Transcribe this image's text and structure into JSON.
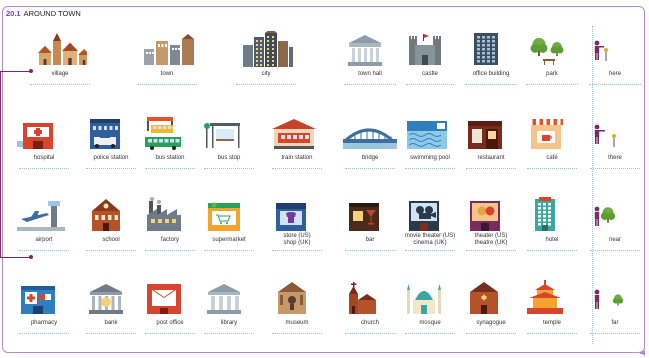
{
  "section": {
    "number": "20.1",
    "title": "AROUND TOWN"
  },
  "rows": [
    [
      "village",
      "town",
      "city",
      "town hall",
      "castle",
      "office building",
      "park",
      "here"
    ],
    [
      "hospital",
      "police station",
      "bus station",
      "bus stop",
      "train station",
      "bridge",
      "swimming pool",
      "restaurant",
      "café",
      "there"
    ],
    [
      "airport",
      "school",
      "factory",
      "supermarket",
      "store (US)\nshop (UK)",
      "bar",
      "movie theater (US)\ncinema (UK)",
      "theater (US)\ntheatre (UK)",
      "hotel",
      "near"
    ],
    [
      "pharmacy",
      "bank",
      "post office",
      "library",
      "museum",
      "church",
      "mosque",
      "synagogue",
      "temple",
      "far"
    ]
  ],
  "icons": [
    [
      "village-icon",
      "town-icon",
      "city-icon",
      "town-hall-icon",
      "castle-icon",
      "office-building-icon",
      "park-icon",
      "person-here-icon"
    ],
    [
      "hospital-icon",
      "police-station-icon",
      "bus-station-icon",
      "bus-stop-icon",
      "train-station-icon",
      "bridge-icon",
      "swimming-pool-icon",
      "restaurant-icon",
      "cafe-icon",
      "person-there-icon"
    ],
    [
      "airport-icon",
      "school-icon",
      "factory-icon",
      "supermarket-icon",
      "store-icon",
      "bar-icon",
      "cinema-icon",
      "theatre-icon",
      "hotel-icon",
      "person-near-tree-icon"
    ],
    [
      "pharmacy-icon",
      "bank-icon",
      "post-office-icon",
      "library-icon",
      "museum-icon",
      "church-icon",
      "mosque-icon",
      "synagogue-icon",
      "temple-icon",
      "person-far-tree-icon"
    ]
  ],
  "colors": {
    "accent": "#7b3a9a",
    "leader": "#7a2c5e",
    "divider": "#9bc2cf"
  }
}
